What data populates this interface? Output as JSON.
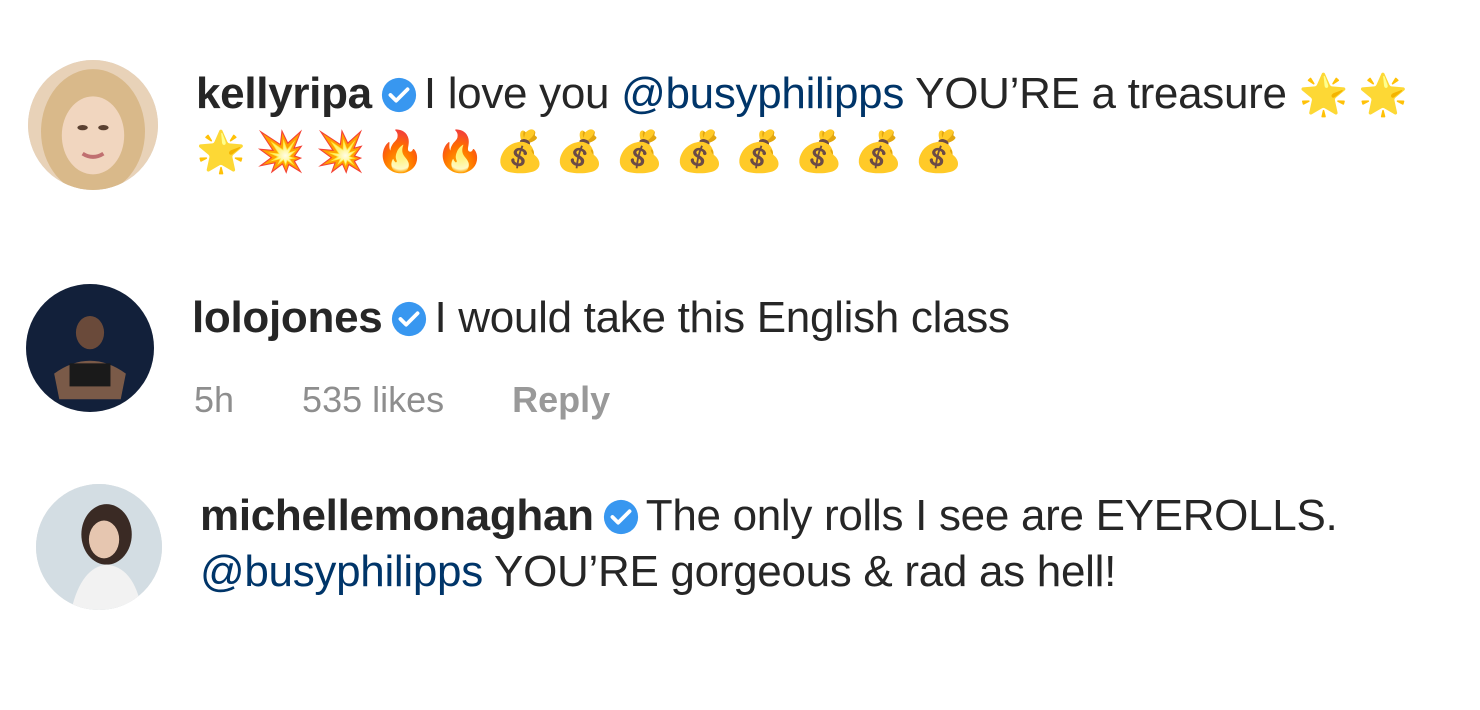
{
  "comments": [
    {
      "username": "kellyripa",
      "verified": true,
      "text_before": "I love you ",
      "mention": "@busyphilipps",
      "text_after": " YOU’RE a treasure ",
      "emoji": "🌟🌟🌟💥💥🔥🔥💰💰💰💰💰💰💰💰"
    },
    {
      "username": "lolojones",
      "verified": true,
      "text": "I would take this English class",
      "time": "5h",
      "likes": "535 likes",
      "reply": "Reply"
    },
    {
      "username": "michellemonaghan",
      "verified": true,
      "text_before": "The only rolls I see are EYEROLLS. ",
      "mention": "@busyphilipps",
      "text_after": " YOU’RE gorgeous & rad as hell!"
    }
  ],
  "colors": {
    "username": "#262626",
    "mention": "#003569",
    "meta": "#8e8e8e",
    "verified": "#3897f0"
  }
}
